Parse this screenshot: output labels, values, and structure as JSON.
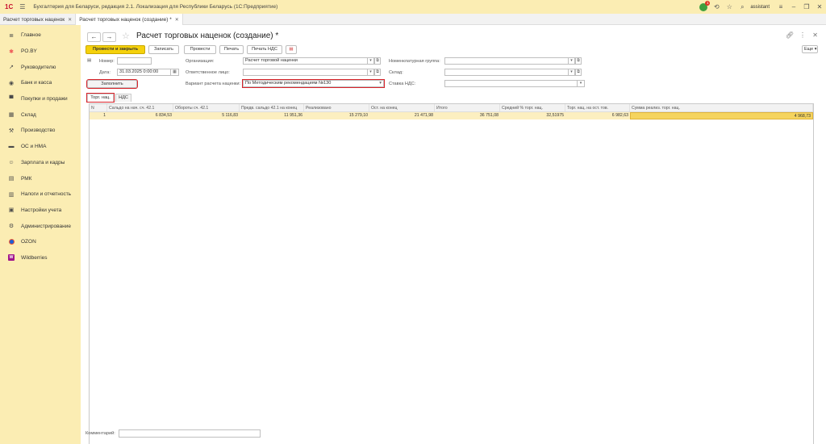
{
  "window": {
    "app_title": "Бухгалтерия для Беларуси, редакция 2.1. Локализация для Республики Беларусь   (1С:Предприятие)",
    "logo_text": "1С",
    "notification_count": "1",
    "user": "assistant"
  },
  "tabs": [
    {
      "label": "Расчет торговых наценок"
    },
    {
      "label": "Расчет торговых наценок (создание) *"
    }
  ],
  "sidebar": {
    "items": [
      {
        "label": "Главное",
        "icon": "menu-lines-icon"
      },
      {
        "label": "PO.BY",
        "icon": "po-by-icon"
      },
      {
        "label": "Руководителю",
        "icon": "trend-icon"
      },
      {
        "label": "Банк и касса",
        "icon": "bank-icon"
      },
      {
        "label": "Покупки и продажи",
        "icon": "cart-icon"
      },
      {
        "label": "Склад",
        "icon": "warehouse-icon"
      },
      {
        "label": "Производство",
        "icon": "factory-icon"
      },
      {
        "label": "ОС и НМА",
        "icon": "truck-icon"
      },
      {
        "label": "Зарплата и кадры",
        "icon": "people-icon"
      },
      {
        "label": "РМК",
        "icon": "cash-register-icon"
      },
      {
        "label": "Налоги и отчетность",
        "icon": "taxes-icon"
      },
      {
        "label": "Настройки учета",
        "icon": "settings-doc-icon"
      },
      {
        "label": "Администрирование",
        "icon": "gear-icon"
      },
      {
        "label": "OZON",
        "icon": "ozon-icon"
      },
      {
        "label": "Wildberries",
        "icon": "wildberries-icon"
      }
    ]
  },
  "doc": {
    "title": "Расчет торговых наценок (создание) *"
  },
  "toolbar": {
    "post_close": "Провести и закрыть",
    "save": "Записать",
    "post": "Провести",
    "print": "Печать",
    "print_vat": "Печать НДС",
    "more": "Еще"
  },
  "form": {
    "number_label": "Номер:",
    "number_value": "",
    "date_label": "Дата:",
    "date_value": "31.03.2025  0:00:00",
    "org_label": "Организация:",
    "org_value": "Расчет торговой наценки",
    "resp_label": "Ответственное лицо:",
    "resp_value": "",
    "variant_label": "Вариант расчета наценки:",
    "variant_value": "По Методическим рекомендациям №130",
    "nom_group_label": "Номенклатурная группа:",
    "nom_group_value": "",
    "warehouse_label": "Склад:",
    "warehouse_value": "",
    "vat_label": "Ставка НДС:",
    "vat_value": "",
    "fill_button": "Заполнить",
    "comment_label": "Комментарий:",
    "comment_value": ""
  },
  "subtabs": [
    "Торг. нац.",
    "НДС"
  ],
  "table": {
    "columns": [
      "N",
      "Сальдо на нач. сч. 42.1",
      "Обороты сч. 42.1",
      "Предв. сальдо 42.1 на конец",
      "Реализовано",
      "Ост. на конец",
      "Итого",
      "Средний % торг. нац.",
      "Торг. нац. на ост. тов.",
      "Сумма реализ. торг. нац."
    ],
    "rows": [
      [
        "1",
        "6 834,53",
        "5 116,83",
        "11 951,36",
        "15 279,10",
        "21 471,98",
        "36 751,08",
        "32,51975",
        "6 982,63",
        "4 968,73"
      ]
    ]
  },
  "colors": {
    "accent": "#f5d10b",
    "sidebar_bg": "#fbedb3",
    "highlight": "#d9232a"
  }
}
